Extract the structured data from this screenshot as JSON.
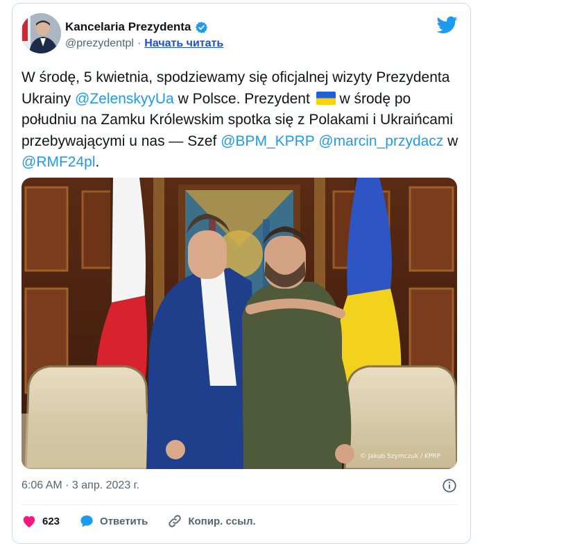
{
  "account": {
    "display_name": "Kancelaria Prezydenta",
    "handle": "@prezydentpl",
    "separator": "·",
    "follow_label": "Начать читать"
  },
  "tweet": {
    "segments": [
      {
        "text": "W środę, 5 kwietnia, spodziewamy się oficjalnej wizyty Prezydenta Ukrainy ",
        "type": "text"
      },
      {
        "text": "@ZelenskyyUa",
        "type": "mention"
      },
      {
        "text": " w Polsce. Prezydent ",
        "type": "text"
      },
      {
        "text": "🇺🇦",
        "type": "flag"
      },
      {
        "text": " w środę po południu na Zamku Królewskim spotka się z Polakami i Ukraińcami przebywającymi u nas  — Szef ",
        "type": "text"
      },
      {
        "text": "@BPM_KPRP",
        "type": "mention"
      },
      {
        "text": " ",
        "type": "text"
      },
      {
        "text": "@marcin_przydacz",
        "type": "mention"
      },
      {
        "text": " w ",
        "type": "text"
      },
      {
        "text": "@RMF24pl",
        "type": "mention"
      },
      {
        "text": ".",
        "type": "text"
      }
    ],
    "photo_credit": "© Jakub Szymczuk / KPRP",
    "timestamp": "6:06 AM · 3 апр. 2023 г."
  },
  "actions": {
    "likes_count": "623",
    "reply_label": "Ответить",
    "copy_link_label": "Копир. ссыл."
  },
  "colors": {
    "link": "#1d9bf0",
    "like": "#f91880",
    "verified": "#1d9bf0",
    "muted": "#536471"
  },
  "icons": [
    "verified-badge-icon",
    "twitter-bird-icon",
    "info-icon",
    "heart-icon",
    "reply-bubble-icon",
    "link-icon",
    "ukraine-flag-icon"
  ]
}
